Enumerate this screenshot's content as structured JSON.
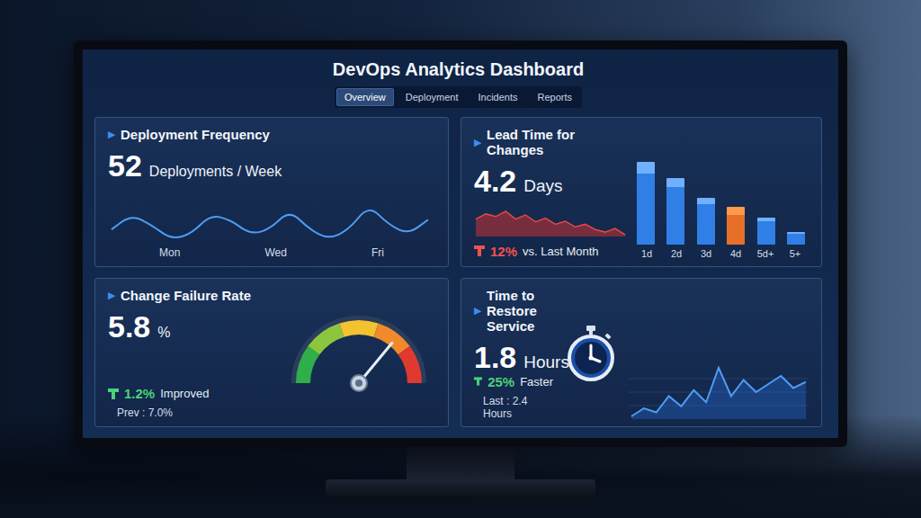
{
  "window": {
    "title": "DevOps Analytics Dashboard"
  },
  "tabs": [
    {
      "label": "Overview",
      "selected": true
    },
    {
      "label": "Deployment",
      "selected": false
    },
    {
      "label": "Incidents",
      "selected": false
    },
    {
      "label": "Reports",
      "selected": false
    }
  ],
  "cards": [
    {
      "kind": "wave",
      "marker": "▶",
      "title": "Deployment Frequency",
      "value": "52",
      "unit": "Deployments / Week",
      "chart": {
        "values": [
          6,
          9,
          7,
          4,
          5,
          9,
          8,
          5,
          6,
          10,
          6,
          4,
          6,
          11,
          7,
          5,
          8
        ],
        "labels": [
          "Mon",
          "Wed",
          "Fri"
        ]
      }
    },
    {
      "kind": "bars",
      "marker": "▶",
      "title": "Lead Time for Changes",
      "value": "4.2",
      "unit": "Days",
      "trend": {
        "good": false,
        "change": "12%",
        "text": "vs. Last Month"
      },
      "sparkline": [
        6,
        7,
        6.5,
        7.5,
        6,
        6.8,
        5.5,
        6.2,
        5,
        5.6,
        4.5,
        5,
        4,
        3.5,
        4.2,
        3
      ],
      "bars": [
        {
          "label": "1d",
          "value": 100,
          "highlighted": false
        },
        {
          "label": "2d",
          "value": 80,
          "highlighted": false
        },
        {
          "label": "3d",
          "value": 56,
          "highlighted": false
        },
        {
          "label": "4d",
          "value": 45,
          "highlighted": true
        },
        {
          "label": "5d+",
          "value": 32,
          "highlighted": false
        },
        {
          "label": "5+",
          "value": 15,
          "highlighted": false
        }
      ]
    },
    {
      "kind": "gauge",
      "marker": "▶",
      "title": "Change Failure Rate",
      "value": "5.8",
      "unit": "%",
      "trend": {
        "good": true,
        "change": "1.2%",
        "text": "Improved"
      },
      "note": "Prev : 7.0%",
      "gauge": {
        "level": 0.72
      }
    },
    {
      "kind": "restore",
      "marker": "▶",
      "title": "Time to Restore Service",
      "value": "1.8",
      "unit": "Hours",
      "trend": {
        "good": true,
        "change": "25%",
        "text": "Faster"
      },
      "note": "Last : 2.4 Hours",
      "line": [
        1.0,
        1.4,
        1.2,
        2.0,
        1.5,
        2.3,
        1.7,
        3.4,
        2.0,
        2.8,
        2.2,
        2.6,
        3.0,
        2.4,
        2.7
      ]
    }
  ]
}
